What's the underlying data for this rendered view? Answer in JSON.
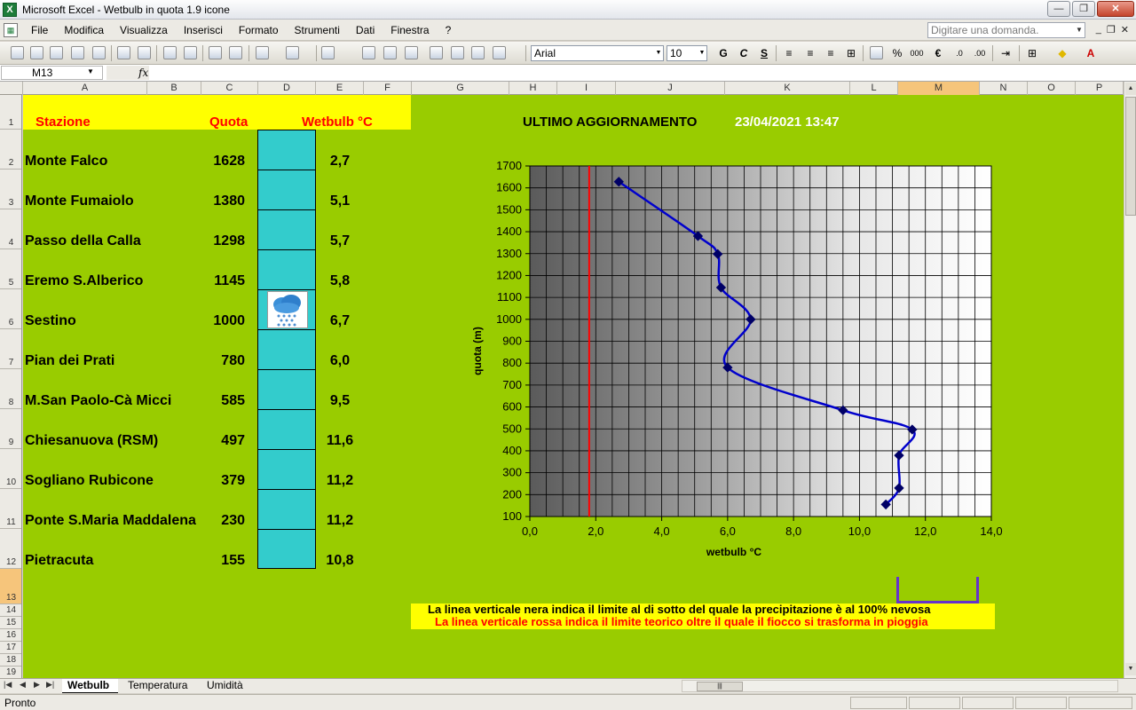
{
  "window": {
    "title": "Microsoft Excel - Wetbulb in quota 1.9 icone",
    "app_icon": "excel-icon"
  },
  "menu": {
    "items": [
      "File",
      "Modifica",
      "Visualizza",
      "Inserisci",
      "Formato",
      "Strumenti",
      "Dati",
      "Finestra",
      "?"
    ],
    "help_placeholder": "Digitare una domanda."
  },
  "toolbar": {
    "font_name": "Arial",
    "font_size": "10",
    "bold": "G",
    "italic": "C",
    "underline": "S",
    "percent": "%",
    "thousands": "000",
    "euro": "€"
  },
  "formula_bar": {
    "name_box": "M13",
    "fx": "fx",
    "content": ""
  },
  "columns": [
    "A",
    "B",
    "C",
    "D",
    "E",
    "F",
    "G",
    "H",
    "I",
    "J",
    "K",
    "L",
    "M",
    "N",
    "O",
    "P"
  ],
  "active_column": "M",
  "active_row": "13",
  "rows": [
    "1",
    "2",
    "3",
    "4",
    "5",
    "6",
    "7",
    "8",
    "9",
    "10",
    "11",
    "12",
    "13",
    "14",
    "15",
    "16",
    "17",
    "18",
    "19"
  ],
  "table": {
    "headers": {
      "station": "Stazione",
      "quota": "Quota",
      "wetbulb": "Wetbulb °C"
    },
    "rows": [
      {
        "station": "Monte Falco",
        "quota": "1628",
        "wetbulb": "2,7"
      },
      {
        "station": "Monte Fumaiolo",
        "quota": "1380",
        "wetbulb": "5,1"
      },
      {
        "station": "Passo della Calla",
        "quota": "1298",
        "wetbulb": "5,7"
      },
      {
        "station": "Eremo S.Alberico",
        "quota": "1145",
        "wetbulb": "5,8"
      },
      {
        "station": "Sestino",
        "quota": "1000",
        "wetbulb": "6,7"
      },
      {
        "station": "Pian dei Prati",
        "quota": "780",
        "wetbulb": "6,0"
      },
      {
        "station": "M.San Paolo-Cà Micci",
        "quota": "585",
        "wetbulb": "9,5"
      },
      {
        "station": "Chiesanuova (RSM)",
        "quota": "497",
        "wetbulb": "11,6"
      },
      {
        "station": "Sogliano Rubicone",
        "quota": "379",
        "wetbulb": "11,2"
      },
      {
        "station": "Ponte S.Maria Maddalena",
        "quota": "230",
        "wetbulb": "11,2"
      },
      {
        "station": "Pietracuta",
        "quota": "155",
        "wetbulb": "10,8"
      }
    ],
    "icon": "rain-cloud-icon"
  },
  "update": {
    "label": "ULTIMO AGGIORNAMENTO",
    "datetime": "23/04/2021 13:47"
  },
  "notes": {
    "black_line": "La linea verticale nera indica il limite al di sotto del quale la precipitazione è al 100% nevosa",
    "red_line": "La linea verticale rossa indica il limite teorico oltre il quale il fiocco si trasforma in pioggia"
  },
  "chart_data": {
    "type": "scatter",
    "xlabel": "wetbulb °C",
    "ylabel": "quota (m)",
    "xlim": [
      0,
      14
    ],
    "ylim": [
      100,
      1700
    ],
    "x_ticks": [
      "0,0",
      "2,0",
      "4,0",
      "6,0",
      "8,0",
      "10,0",
      "12,0",
      "14,0"
    ],
    "y_ticks": [
      "1700",
      "1600",
      "1500",
      "1400",
      "1300",
      "1200",
      "1100",
      "1000",
      "900",
      "800",
      "700",
      "600",
      "500",
      "400",
      "300",
      "200",
      "100"
    ],
    "series": [
      {
        "points": [
          {
            "x": 2.7,
            "y": 1628
          },
          {
            "x": 5.1,
            "y": 1380
          },
          {
            "x": 5.7,
            "y": 1298
          },
          {
            "x": 5.8,
            "y": 1145
          },
          {
            "x": 6.7,
            "y": 1000
          },
          {
            "x": 6.0,
            "y": 780
          },
          {
            "x": 9.5,
            "y": 585
          },
          {
            "x": 11.6,
            "y": 497
          },
          {
            "x": 11.2,
            "y": 379
          },
          {
            "x": 11.2,
            "y": 230
          },
          {
            "x": 10.8,
            "y": 155
          }
        ],
        "color": "#0000cc"
      }
    ],
    "red_limit_x": 1.8,
    "grid": true,
    "colors": {
      "background": "#99cc00",
      "line": "#0000cc",
      "limit": "#ff0000"
    }
  },
  "sheet_tabs": [
    "Wetbulb",
    "Temperatura",
    "Umidità"
  ],
  "active_tab": "Wetbulb",
  "status": {
    "text": "Pronto"
  }
}
